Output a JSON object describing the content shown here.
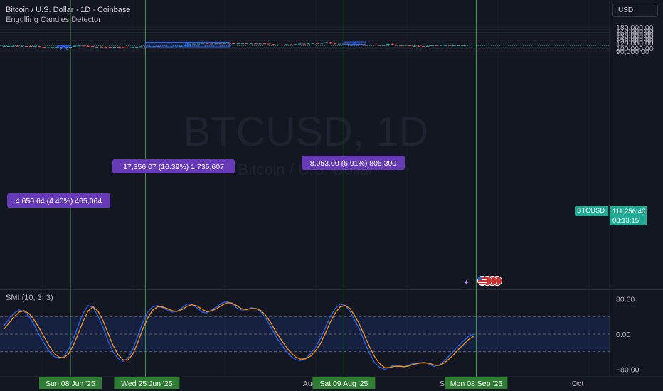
{
  "header": {
    "title": "Bitcoin / U.S. Dollar · 1D · Coinbase",
    "indicator": "Engulfing Candles Detector",
    "currency_button": "USD"
  },
  "watermark": {
    "symbol": "BTCUSD, 1D",
    "name": "Bitcoin / U.S. Dollar"
  },
  "price_scale": {
    "labels": [
      "180,000.00",
      "170,000.00",
      "160,000.00",
      "150,000.00",
      "140,000.00",
      "130,000.00",
      "120,000.00",
      "100,000.00",
      "90,000.00"
    ]
  },
  "last_price": {
    "symbol": "BTCUSD",
    "price": "111,256.40",
    "countdown": "08:13:15"
  },
  "smi": {
    "label": "SMI (10, 3, 3)",
    "scale_labels": [
      "80.00",
      "0.00",
      "−80.00"
    ]
  },
  "time_axis": {
    "labels": [
      "Aug",
      "Sep",
      "Oct"
    ],
    "highlight_labels": [
      "Sun 08 Jun '25",
      "Wed 25 Jun '25",
      "Sat 09 Aug '25",
      "Mon 08 Sep '25"
    ]
  },
  "measure_boxes": [
    {
      "label": "4,650.64 (4.40%) 465,064"
    },
    {
      "label": "17,356.07 (16.39%) 1,735,607"
    },
    {
      "label": "8,053.00 (6.91%) 805,300"
    }
  ],
  "colors": {
    "background": "#131722",
    "up": "#26a69a",
    "down": "#ef5350",
    "accent": "#2962ff",
    "label_bg": "#673ab7",
    "last_price": "#22ab94",
    "smi_line": "#2962ff",
    "smi_signal": "#ff9800",
    "vertical_marker": "#4caf50"
  },
  "chart_data": {
    "type": "candlestick",
    "title": "Bitcoin / U.S. Dollar · 1D · Coinbase",
    "x_start": "2025-05-24",
    "x_end": "2025-09-08",
    "ylim": [
      84000,
      186000
    ],
    "vertical_markers": [
      "2025-06-08",
      "2025-06-25",
      "2025-08-09",
      "2025-09-08"
    ],
    "close": [
      108200,
      108900,
      109100,
      107800,
      108600,
      108300,
      107600,
      107900,
      105600,
      103900,
      104300,
      105300,
      105900,
      104600,
      105900,
      106200,
      110100,
      110200,
      109500,
      108700,
      105900,
      106300,
      105800,
      105500,
      104700,
      106100,
      104500,
      103300,
      101100,
      105400,
      106100,
      107400,
      107300,
      107700,
      108400,
      107200,
      106800,
      106900,
      107100,
      107400,
      108300,
      111300,
      116000,
      117400,
      117700,
      119900,
      117800,
      117400,
      118500,
      117800,
      119200,
      118700,
      117400,
      118800,
      119500,
      117900,
      118400,
      118100,
      118400,
      117900,
      115800,
      113600,
      114000,
      113300,
      115100,
      114600,
      115700,
      117600,
      116700,
      118000,
      119500,
      118900,
      120200,
      123300,
      118200,
      117300,
      117400,
      117500,
      114300,
      116100,
      115000,
      112800,
      112400,
      113600,
      112000,
      111200,
      111700,
      116900,
      112600,
      111800,
      110200,
      112500,
      108200,
      108900,
      108800,
      108400,
      109200,
      111300,
      110700,
      111700,
      112000,
      110700,
      111100,
      111200,
      111256
    ]
  }
}
